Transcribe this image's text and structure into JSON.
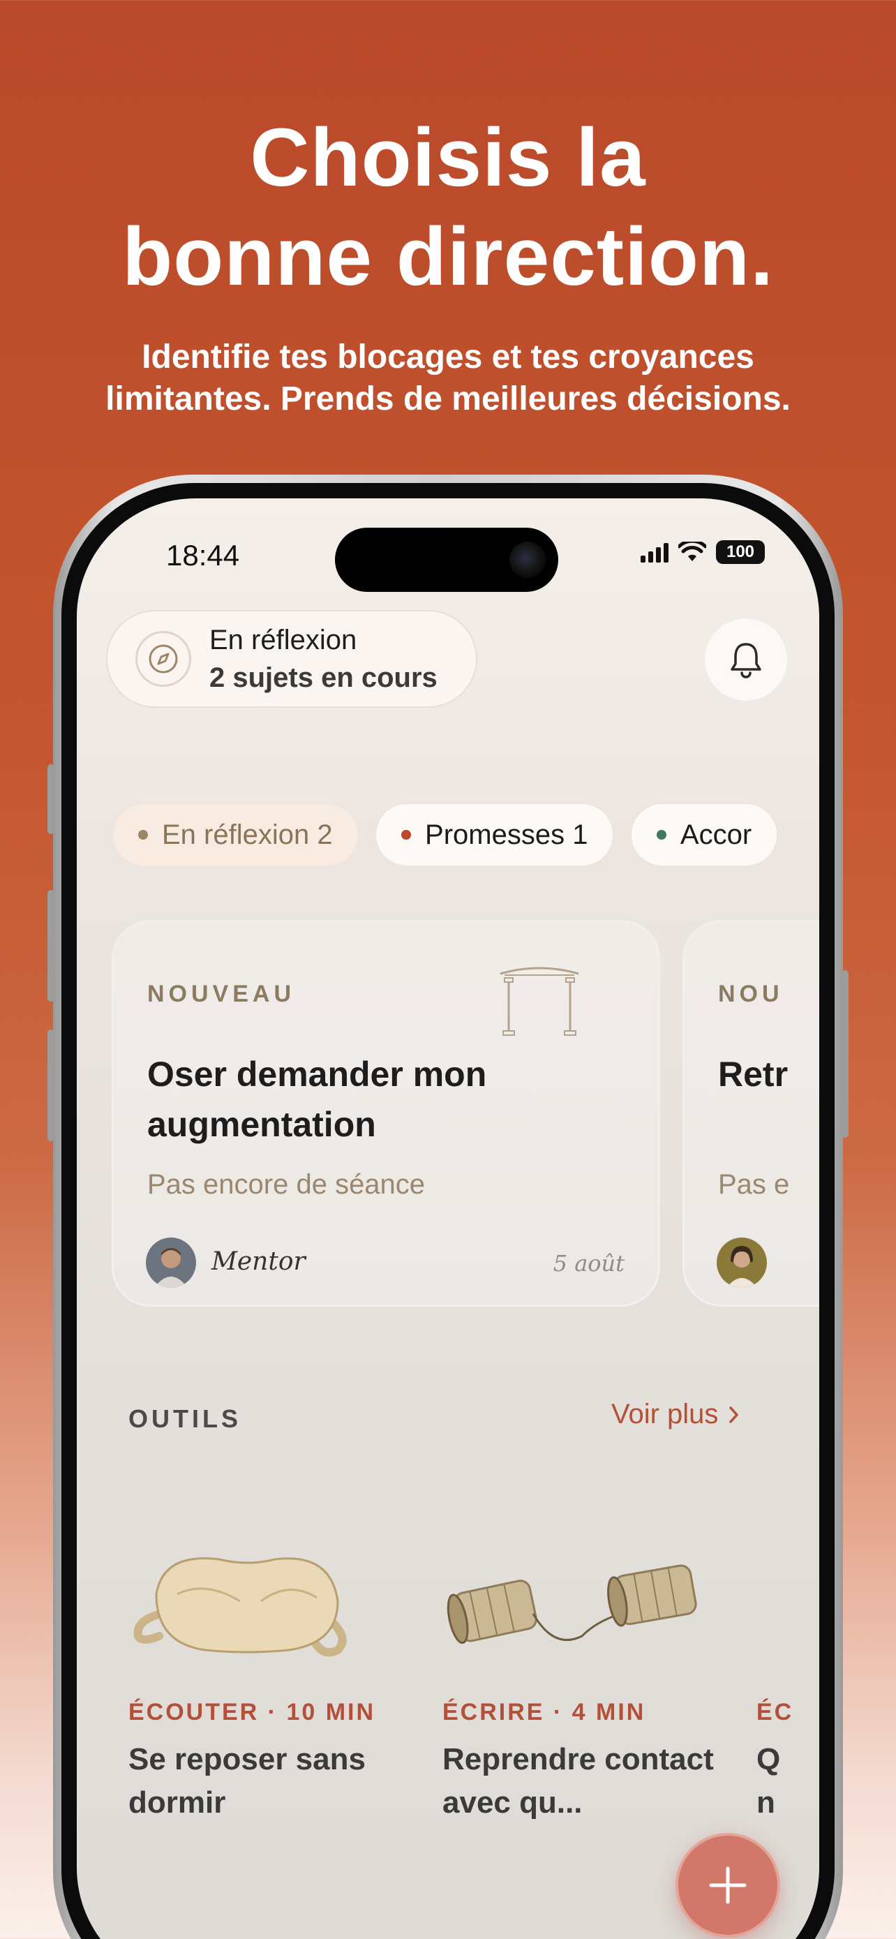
{
  "marketing": {
    "headline_line1": "Choisis la",
    "headline_line2": "bonne direction.",
    "subline_line1": "Identifie tes blocages et tes croyances",
    "subline_line2": "limitantes. Prends de meilleures décisions."
  },
  "status_bar": {
    "time": "18:44",
    "battery": "100"
  },
  "header": {
    "status_title": "En réflexion",
    "status_subtitle": "2 sujets en cours",
    "icons": {
      "status": "compass-icon",
      "notifications": "bell-icon"
    }
  },
  "filters": [
    {
      "label": "En réflexion 2",
      "dot_color": "#9c8668",
      "active": true
    },
    {
      "label": "Promesses 1",
      "dot_color": "#b9492a",
      "active": false
    },
    {
      "label": "Accor",
      "dot_color": "#3b7a5e",
      "active": false
    }
  ],
  "subjects": [
    {
      "badge": "NOUVEAU",
      "title": "Oser demander mon augmentation",
      "subtitle": "Pas encore de séance",
      "mentor": "Mentor",
      "date": "5 août"
    },
    {
      "badge": "NOU",
      "title": "Retr",
      "subtitle": "Pas e"
    }
  ],
  "tools_section": {
    "title": "OUTILS",
    "more_label": "Voir plus",
    "items": [
      {
        "kicker": "ÉCOUTER · 10 MIN",
        "title": "Se reposer sans dormir",
        "image": "sleep-mask"
      },
      {
        "kicker": "ÉCRIRE · 4 MIN",
        "title": "Reprendre contact avec qu...",
        "image": "tin-can-phone"
      },
      {
        "kicker": "ÉC",
        "title": "Q n"
      }
    ]
  },
  "fab": {
    "icon": "plus-icon"
  },
  "colors": {
    "accent": "#b55036",
    "background": "#c4562f"
  }
}
